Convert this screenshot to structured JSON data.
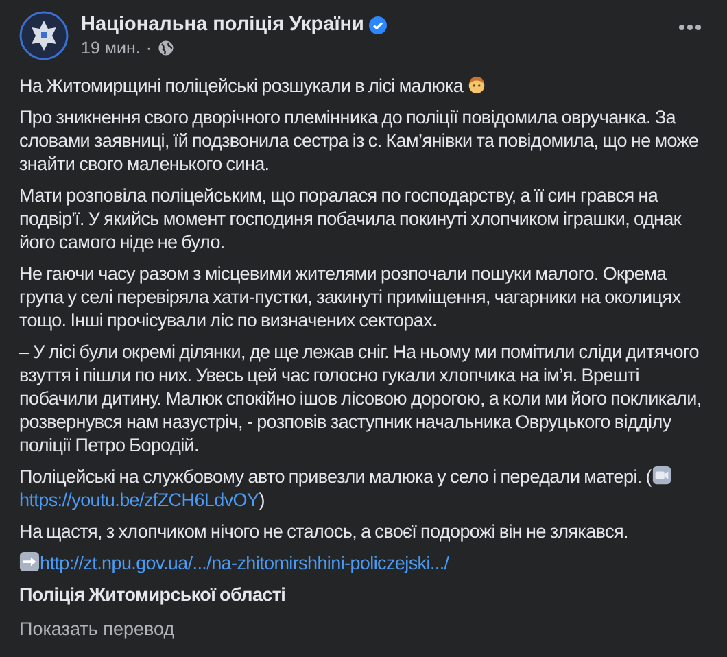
{
  "post": {
    "author": "Національна поліція України",
    "verified": true,
    "time": "19 мин.",
    "separator": "·",
    "paragraphs": [
      {
        "kind": "plain",
        "parts": [
          {
            "kind": "text",
            "text": "На Житомирщині поліцейські розшукали в лісі малюка "
          },
          {
            "kind": "face"
          }
        ]
      },
      {
        "kind": "plain",
        "parts": [
          {
            "kind": "text",
            "text": "Про зникнення свого дворічного племінника до поліції повідомила овручанка. За словами заявниці, їй подзвонила сестра із с. Кам’янівки та повідомила, що не може знайти свого маленького сина."
          }
        ]
      },
      {
        "kind": "plain",
        "parts": [
          {
            "kind": "text",
            "text": "Мати розповіла поліцейським, що поралася по господарству, а її син грався на подвір'ї. У якийсь момент господиня побачила покинуті хлопчиком іграшки, однак його самого ніде не було."
          }
        ]
      },
      {
        "kind": "plain",
        "parts": [
          {
            "kind": "text",
            "text": "Не гаючи часу разом з місцевими жителями розпочали пошуки малого. Окрема група у селі перевіряла хати-пустки, закинуті приміщення, чагарники на околицях тощо. Інші прочісували ліс по визначених секторах."
          }
        ]
      },
      {
        "kind": "plain",
        "parts": [
          {
            "kind": "text",
            "text": "– У лісі були окремі ділянки, де ще лежав сніг. На ньому ми помітили сліди дитячого взуття і пішли по них. Увесь цей час голосно гукали хлопчика на ім’я. Врешті побачили дитину. Малюк спокійно ішов лісовою дорогою, а коли ми його покликали, розвернувся нам назустріч, - розповів заступник начальника Овруцького відділу поліції Петро Бородій."
          }
        ]
      },
      {
        "kind": "plain",
        "parts": [
          {
            "kind": "text",
            "text": "Поліцейські на службовому авто привезли малюка у село і передали матері. ("
          },
          {
            "kind": "camera"
          },
          {
            "kind": "link",
            "text": "https://youtu.be/zfZCH6LdvOY"
          },
          {
            "kind": "text",
            "text": ")"
          }
        ]
      },
      {
        "kind": "plain",
        "parts": [
          {
            "kind": "text",
            "text": "На щастя, з хлопчиком нічого не сталось, а своєї подорожі він не злякався."
          }
        ]
      },
      {
        "kind": "plain",
        "parts": [
          {
            "kind": "arrow"
          },
          {
            "kind": "link",
            "text": "http://zt.npu.gov.ua/.../na-zhitomirshhini-policzejski.../"
          }
        ]
      },
      {
        "kind": "signature",
        "parts": [
          {
            "kind": "text",
            "text": "Поліція Житомирської області"
          }
        ]
      }
    ],
    "translate": "Показать перевод"
  }
}
